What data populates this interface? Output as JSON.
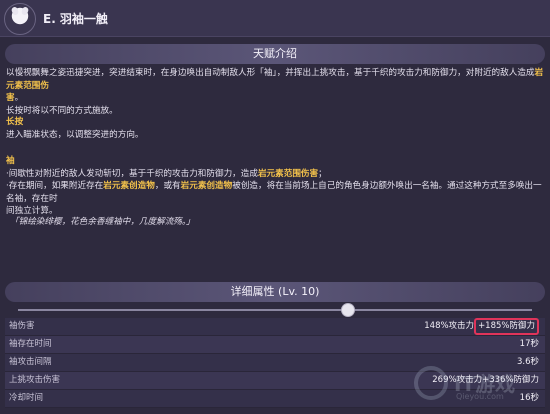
{
  "skill": {
    "title": "E. 羽袖一触"
  },
  "talent_section": {
    "header": "天赋介绍",
    "intro_line1_a": "以慢视飘舞之姿迅捷突进，突进结束时，在身边唤出自动制敌人形「袖」，并挥出上挑攻击，基于千织的攻击力和防御力，对附近的敌人造成",
    "intro_line1_hl": "岩元素范围伤",
    "intro_line2_hl": "害",
    "intro_line2_b": "。",
    "intro_line3": "长按时将以不同的方式施放。",
    "hold_title": "长按",
    "hold_text": "进入瞄准状态，以调整突进的方向。",
    "sleeve_title": "袖",
    "sleeve_line1_a": "·间歇性对附近的敌人发动斩切，基于千织的攻击力和防御力，造成",
    "sleeve_line1_hl": "岩元素范围伤害",
    "sleeve_line1_b": "；",
    "sleeve_line2_a": "·存在期间，如果附近存在",
    "sleeve_line2_hl1": "岩元素创造物",
    "sleeve_line2_b": "，或有",
    "sleeve_line2_hl2": "岩元素创造物",
    "sleeve_line2_c": "被创造，将在当前场上自己的角色身边额外唤出一名袖。通过这种方式至多唤出一名袖，存在时",
    "sleeve_line3": "间独立计算。",
    "quote": "「锦绘染绯樱，花色余香缠袖中，几度解流殇。」"
  },
  "detail_section": {
    "header": "详细属性 (Lv. 10)",
    "level_fraction": 0.64
  },
  "stats": [
    {
      "label": "袖伤害",
      "value_main": "148%攻击力",
      "value_boxed": "+185%防御力"
    },
    {
      "label": "袖存在时间",
      "value": "17秒"
    },
    {
      "label": "袖攻击间隔",
      "value": "3.6秒"
    },
    {
      "label": "上挑攻击伤害",
      "value": "269%攻击力+336%防御力"
    },
    {
      "label": "冷却时间",
      "value": "16秒"
    }
  ],
  "watermark": {
    "text": "IT游戏",
    "domain": "Qieyou.com"
  },
  "colors": {
    "background": "#2e2a3e",
    "highlight": "#f2c14b",
    "box_border": "#e0345a"
  }
}
